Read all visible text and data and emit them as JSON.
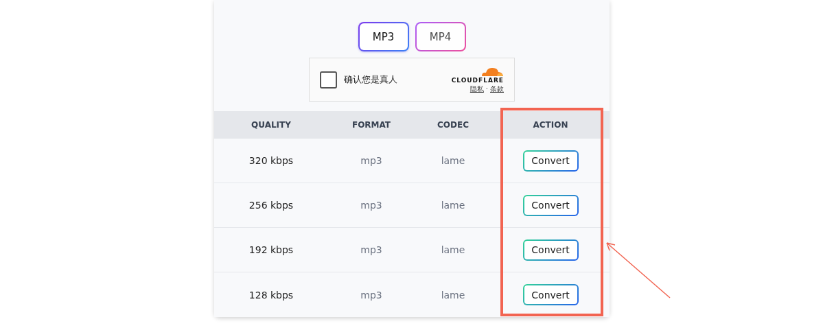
{
  "formats": [
    {
      "label": "MP3",
      "selected": true
    },
    {
      "label": "MP4",
      "selected": false
    }
  ],
  "captcha": {
    "label": "确认您是真人",
    "checked": false,
    "brand": "CLOUDFLARE",
    "links": [
      "隐私",
      "条款"
    ],
    "separator": "·"
  },
  "table": {
    "columns": [
      "QUALITY",
      "FORMAT",
      "CODEC",
      "ACTION"
    ],
    "rows": [
      {
        "quality": "320 kbps",
        "format": "mp3",
        "codec": "lame",
        "action": "Convert"
      },
      {
        "quality": "256 kbps",
        "format": "mp3",
        "codec": "lame",
        "action": "Convert"
      },
      {
        "quality": "192 kbps",
        "format": "mp3",
        "codec": "lame",
        "action": "Convert"
      },
      {
        "quality": "128 kbps",
        "format": "mp3",
        "codec": "lame",
        "action": "Convert"
      }
    ]
  }
}
